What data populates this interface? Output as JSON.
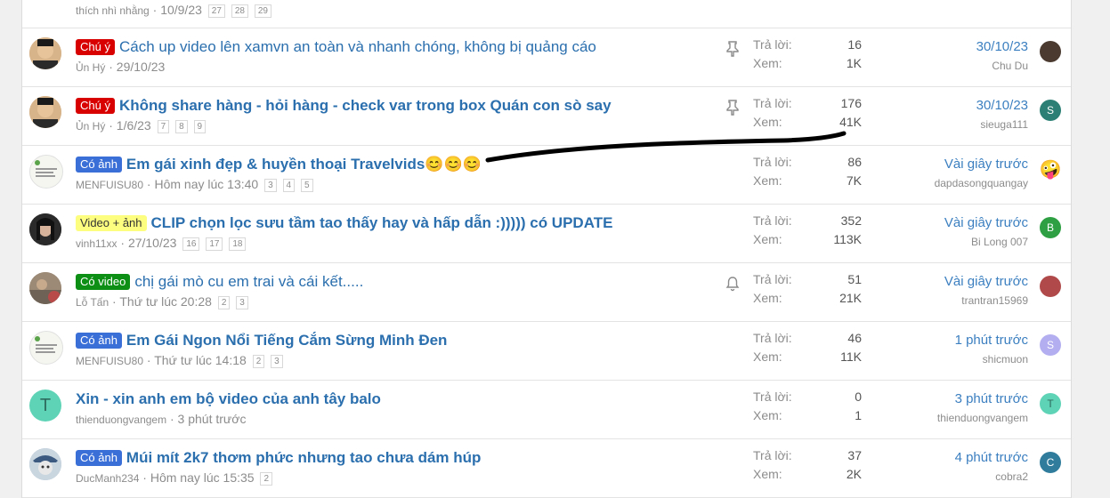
{
  "threads": [
    {
      "author": "thích nhì nhằng",
      "date": "10/9/23",
      "pages": [
        "27",
        "28",
        "29"
      ]
    },
    {
      "prefix": "Chú ý",
      "prefix_style": "red",
      "title": "Cách up video lên xamvn an toàn và nhanh chóng, không bị quảng cáo",
      "bold": false,
      "author": "Ủn Hý",
      "date": "29/10/23",
      "pages": [],
      "status_icon": "pin-icon",
      "replies_label": "Trả lời:",
      "replies": "16",
      "views_label": "Xem:",
      "views": "1K",
      "last_when": "30/10/23",
      "last_who": "Chu Du",
      "avatar_color": "#c9a27a",
      "mini_color": "#4a3a30",
      "mini_letter": ""
    },
    {
      "prefix": "Chú ý",
      "prefix_style": "red",
      "title": "Không share hàng - hỏi hàng - check var trong box Quán con sò say",
      "bold": true,
      "author": "Ủn Hý",
      "date": "1/6/23",
      "pages": [
        "7",
        "8",
        "9"
      ],
      "status_icon": "pin-icon",
      "replies_label": "Trả lời:",
      "replies": "176",
      "views_label": "Xem:",
      "views": "41K",
      "last_when": "30/10/23",
      "last_who": "sieuga111",
      "avatar_color": "#c9a27a",
      "mini_color": "#2b7f74",
      "mini_letter": "S"
    },
    {
      "prefix": "Có ảnh",
      "prefix_style": "blue",
      "title": "Em gái xinh đẹp & huyền thoại Travelvids",
      "emoji": "😊😊😊",
      "bold": true,
      "author": "MENFUISU80",
      "date": "Hôm nay lúc 13:40",
      "pages": [
        "3",
        "4",
        "5"
      ],
      "replies_label": "Trả lời:",
      "replies": "86",
      "views_label": "Xem:",
      "views": "7K",
      "last_when": "Vài giây trước",
      "last_who": "dapdasongquangay",
      "avatar_color": "#eef3e6",
      "mini_color": "#f2c230",
      "mini_letter": "🤪"
    },
    {
      "prefix": "Video + ảnh",
      "prefix_style": "yellow",
      "title": "CLIP chọn lọc sưu tầm tao thấy hay và hấp dẫn :))))) có UPDATE",
      "bold": true,
      "author": "vinh11xx",
      "date": "27/10/23",
      "pages": [
        "16",
        "17",
        "18"
      ],
      "replies_label": "Trả lời:",
      "replies": "352",
      "views_label": "Xem:",
      "views": "113K",
      "last_when": "Vài giây trước",
      "last_who": "Bi Long 007",
      "avatar_color": "#333333",
      "mini_color": "#2ea043",
      "mini_letter": "B"
    },
    {
      "prefix": "Có video",
      "prefix_style": "green",
      "title": "chị gái mò cu em trai và cái kết.....",
      "bold": false,
      "author": "Lỗ Tấn",
      "date": "Thứ tư lúc 20:28",
      "pages": [
        "2",
        "3"
      ],
      "status_icon": "bell-icon",
      "replies_label": "Trả lời:",
      "replies": "51",
      "views_label": "Xem:",
      "views": "21K",
      "last_when": "Vài giây trước",
      "last_who": "trantran15969",
      "avatar_color": "#8a7a6a",
      "mini_color": "#b04a4a",
      "mini_letter": ""
    },
    {
      "prefix": "Có ảnh",
      "prefix_style": "blue",
      "title": "Em Gái Ngon Nổi Tiếng Cắm Sừng Minh Đen",
      "bold": true,
      "author": "MENFUISU80",
      "date": "Thứ tư lúc 14:18",
      "pages": [
        "2",
        "3"
      ],
      "replies_label": "Trả lời:",
      "replies": "46",
      "views_label": "Xem:",
      "views": "11K",
      "last_when": "1 phút trước",
      "last_who": "shicmuon",
      "avatar_color": "#eef3e6",
      "mini_color": "#b3aef0",
      "mini_letter": "S"
    },
    {
      "prefix": "",
      "title": "Xin - xin anh em bộ video của anh tây balo",
      "bold": true,
      "author": "thienduongvangem",
      "date": "3 phút trước",
      "pages": [],
      "replies_label": "Trả lời:",
      "replies": "0",
      "views_label": "Xem:",
      "views": "1",
      "last_when": "3 phút trước",
      "last_who": "thienduongvangem",
      "avatar_color": "#5fd3b6",
      "avatar_letter": "T",
      "mini_color": "#5fd3b6",
      "mini_letter": "T"
    },
    {
      "prefix": "Có ảnh",
      "prefix_style": "blue",
      "title": "Múi mít 2k7 thơm phức nhưng tao chưa dám húp",
      "bold": true,
      "author": "DucManh234",
      "date": "Hôm nay lúc 15:35",
      "pages": [
        "2"
      ],
      "replies_label": "Trả lời:",
      "replies": "37",
      "views_label": "Xem:",
      "views": "2K",
      "last_when": "4 phút trước",
      "last_who": "cobra2",
      "avatar_color": "#9fb5c9",
      "mini_color": "#2f7c9c",
      "mini_letter": "C"
    }
  ]
}
